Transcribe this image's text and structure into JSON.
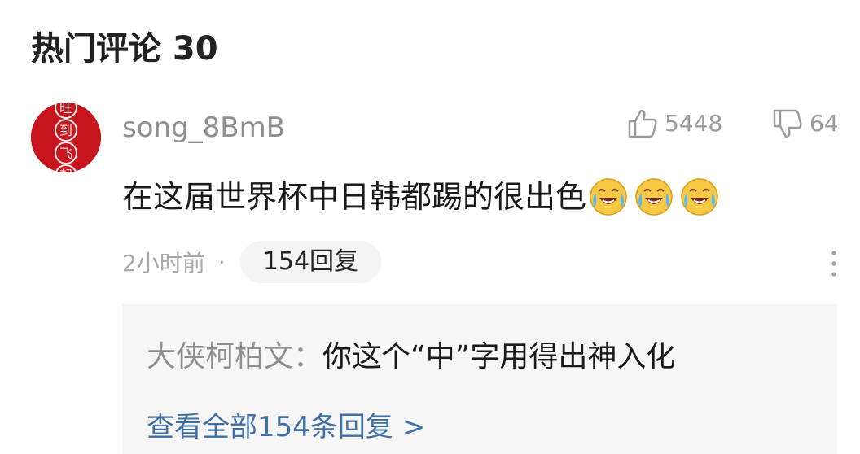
{
  "section": {
    "title": "热门评论 30"
  },
  "comment": {
    "username": "song_8BmB",
    "avatar_chars": [
      "旺",
      "到",
      "飞",
      "起"
    ],
    "likes": "5448",
    "dislikes": "64",
    "text": "在这届世界杯中日韩都踢的很出色",
    "emojis": [
      "crying-laugh-emoji",
      "crying-laugh-emoji",
      "crying-laugh-emoji"
    ],
    "time": "2小时前",
    "separator": "·",
    "reply_count_label": "154回复"
  },
  "reply": {
    "author": "大侠柯柏文：",
    "text": "你这个“中”字用得出神入化",
    "view_all_label": "查看全部154条回复 >"
  },
  "colors": {
    "avatar_red": "#c8141d",
    "link_blue": "#3f6fa5",
    "meta_gray": "#a8a8a8",
    "reply_bg": "#f6f6f6"
  }
}
